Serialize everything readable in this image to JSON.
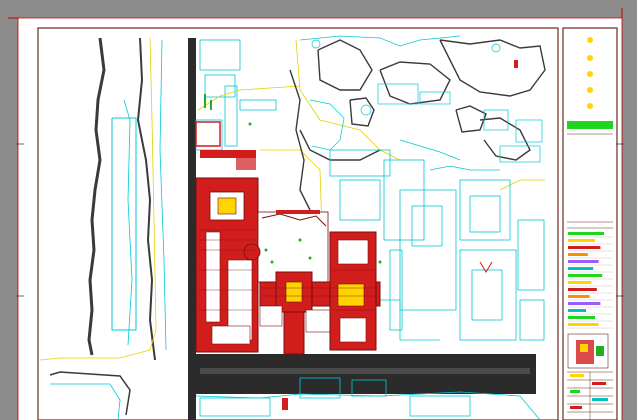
{
  "canvas": {
    "background": "#8c8c8c",
    "paper": "#ffffff",
    "frame_color": "#6b2a1e",
    "ruler_color": "#c00000"
  },
  "title_block": {
    "banner_color": "#ffd400",
    "status_bar_color": "#1fd61f",
    "legend_swatches": [
      "#1fd61f",
      "#ffd400",
      "#d21d1d",
      "#ff8c00",
      "#9b5cff",
      "#00c0c0"
    ]
  },
  "layers": {
    "building_fill": "#d21d1d",
    "building_outline": "#7a0d0d",
    "cyan_lines": "#00c8d8",
    "yellow_lines": "#e6d000",
    "dark_lines": "#3a3a3a",
    "road_fill": "#2b2b2b",
    "green_marks": "#1fb01f"
  }
}
